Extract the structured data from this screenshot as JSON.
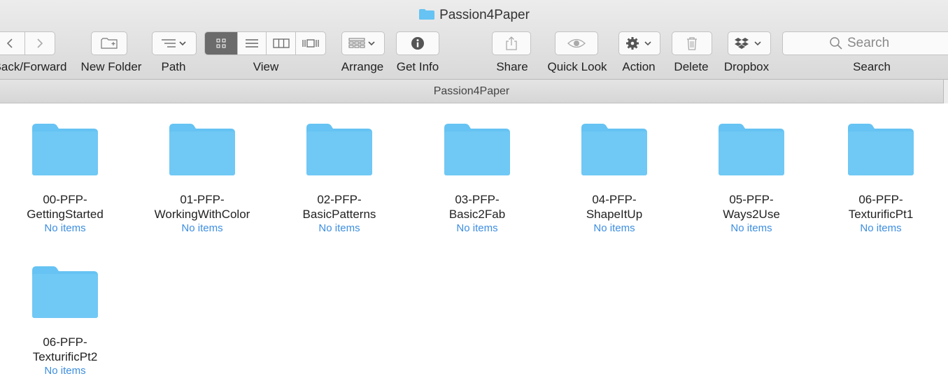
{
  "window": {
    "title": "Passion4Paper",
    "path_title": "Passion4Paper"
  },
  "toolbar": {
    "back_forward_label": "Back/Forward",
    "new_folder_label": "New Folder",
    "path_label": "Path",
    "view_label": "View",
    "arrange_label": "Arrange",
    "get_info_label": "Get Info",
    "share_label": "Share",
    "quick_look_label": "Quick Look",
    "action_label": "Action",
    "delete_label": "Delete",
    "dropbox_label": "Dropbox",
    "search_label": "Search",
    "search_placeholder": "Search",
    "view_mode_selected": "icon"
  },
  "folders": [
    {
      "line1": "00-PFP-",
      "line2": "GettingStarted",
      "sub": "No items"
    },
    {
      "line1": "01-PFP-",
      "line2": "WorkingWithColor",
      "sub": "No items"
    },
    {
      "line1": "02-PFP-",
      "line2": "BasicPatterns",
      "sub": "No items"
    },
    {
      "line1": "03-PFP-",
      "line2": "Basic2Fab",
      "sub": "No items"
    },
    {
      "line1": "04-PFP-",
      "line2": "ShapeItUp",
      "sub": "No items"
    },
    {
      "line1": "05-PFP-",
      "line2": "Ways2Use",
      "sub": "No items"
    },
    {
      "line1": "06-PFP-",
      "line2": "TexturificPt1",
      "sub": "No items"
    },
    {
      "line1": "06-PFP-",
      "line2": "TexturificPt2",
      "sub": "No items"
    }
  ],
  "colors": {
    "folder": "#66c3f3",
    "subtitle": "#3d8ee0"
  }
}
